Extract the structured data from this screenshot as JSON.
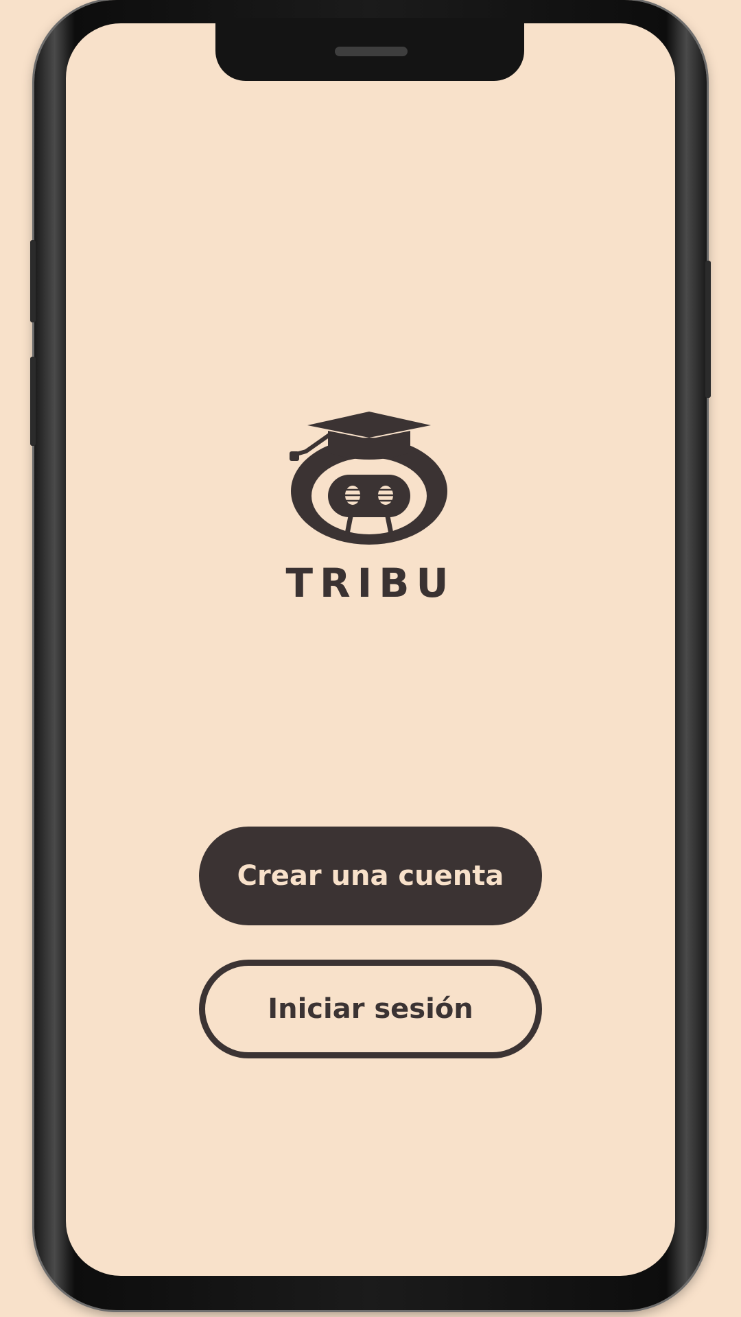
{
  "app": {
    "brand_name": "TRIBU",
    "logo": "tribu-mascot-graduation-cap-logo"
  },
  "actions": {
    "create_account_label": "Crear una cuenta",
    "sign_in_label": "Iniciar sesión"
  },
  "theme": {
    "background": "#f8e1ca",
    "primary": "#3b3333",
    "on_primary": "#f8e1ca"
  }
}
